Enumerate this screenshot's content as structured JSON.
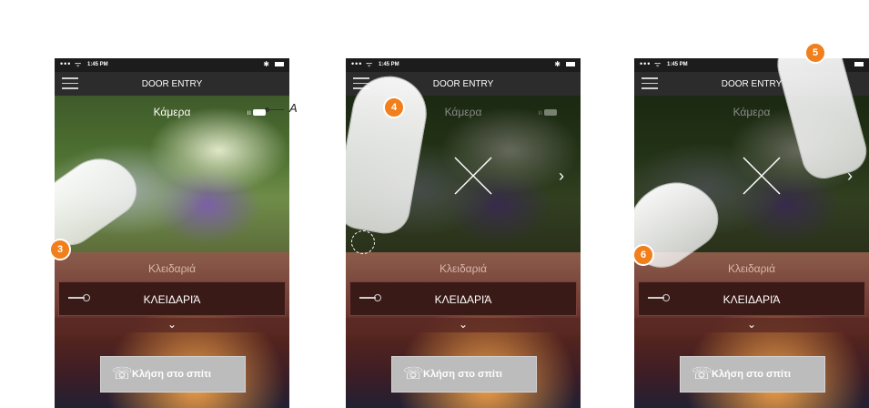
{
  "status": {
    "dots": "•••",
    "wifi": "ᯤ",
    "time": "1:45 PM",
    "bluetooth": "✱"
  },
  "app": {
    "title": "DOOR ENTRY"
  },
  "camera": {
    "label": "Κάμερα",
    "signal": "ıı"
  },
  "lock": {
    "header": "Κλειδαριά",
    "item": "ΚΛΕΙΔΑΡΙΆ"
  },
  "expand_icon": "⌄",
  "next_icon": "›",
  "call": {
    "label": "Κλήση στο σπίτι",
    "icon": "☏"
  },
  "callout": {
    "letter": "A"
  },
  "steps": [
    "3",
    "4",
    "5",
    "6"
  ],
  "colors": {
    "badge": "#f07f1c",
    "titlebar": "#2c2c2c"
  }
}
